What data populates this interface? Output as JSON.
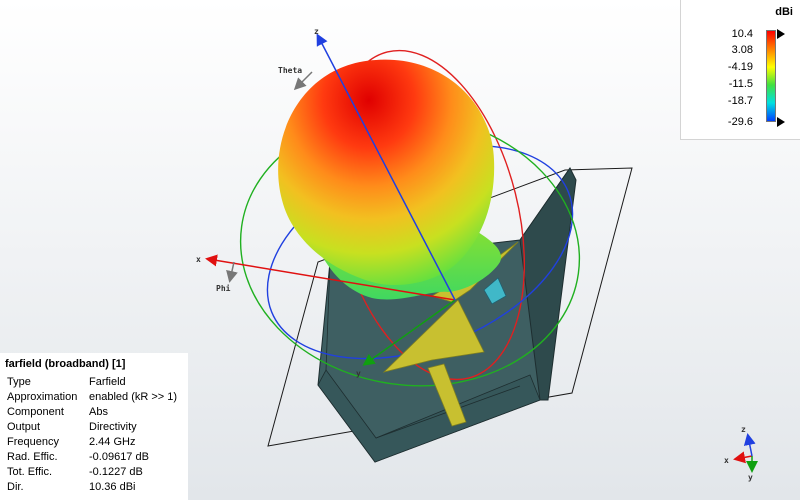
{
  "scene": {
    "axis_labels": {
      "x": "x",
      "y": "y",
      "z": "z",
      "theta": "Theta",
      "phi": "Phi"
    },
    "triad_labels": {
      "x": "x",
      "y": "y",
      "z": "z"
    },
    "colors": {
      "circle_theta": "#e02020",
      "circle_phi": "#2040e0",
      "circle_equator": "#20b020",
      "substrate": "#3e5f62",
      "patch": "#c8c030",
      "feed_port": "#40b8c8",
      "axis_x": "#e01010",
      "axis_y": "#10a010",
      "axis_z": "#2040e0"
    }
  },
  "legend": {
    "unit": "dBi",
    "ticks": [
      "10.4",
      "3.08",
      "-4.19",
      "-11.5",
      "-18.7",
      "-29.6"
    ],
    "max": 10.4,
    "min": -29.6,
    "gradient": [
      "#ff0000",
      "#ff8000",
      "#ffff00",
      "#40e040",
      "#00e0e0",
      "#0040ff"
    ]
  },
  "info": {
    "title": "farfield (broadband) [1]",
    "rows": [
      {
        "key": "Type",
        "value": "Farfield"
      },
      {
        "key": "Approximation",
        "value": "enabled (kR >> 1)"
      },
      {
        "key": "Component",
        "value": "Abs"
      },
      {
        "key": "Output",
        "value": "Directivity"
      },
      {
        "key": "Frequency",
        "value": "2.44 GHz"
      },
      {
        "key": "Rad. Effic.",
        "value": "-0.09617 dB"
      },
      {
        "key": "Tot. Effic.",
        "value": "-0.1227 dB"
      },
      {
        "key": "Dir.",
        "value": "10.36 dBi"
      }
    ]
  }
}
